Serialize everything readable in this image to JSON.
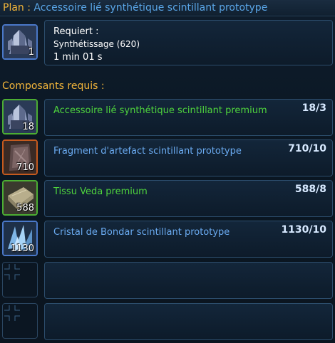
{
  "title": {
    "prefix": "Plan :",
    "name": "Accessoire lié synthétique scintillant prototype"
  },
  "requirements": {
    "label": "Requiert :",
    "skill": "Synthétissage (620)",
    "time": "1 min 01 s",
    "item_qty": "1"
  },
  "components_header": "Composants requis :",
  "components": [
    {
      "name": "Accessoire lié synthétique scintillant premium",
      "count": "18/3",
      "stock": "18",
      "name_color": "#4fd43d"
    },
    {
      "name": "Fragment d'artefact scintillant prototype",
      "count": "710/10",
      "stock": "710",
      "name_color": "#6aaaf0"
    },
    {
      "name": "Tissu Veda premium",
      "count": "588/8",
      "stock": "588",
      "name_color": "#4fd43d"
    },
    {
      "name": "Cristal de Bondar scintillant prototype",
      "count": "1130/10",
      "stock": "1130",
      "name_color": "#6aaaf0"
    }
  ],
  "colors": {
    "title_prefix": "#f2b53a",
    "title_name": "#5aa6e8",
    "premium_green": "#4fd43d",
    "prototype_blue": "#6aaaf0"
  },
  "icons": [
    "armor-crystal-icon",
    "artifact-fragment-icon",
    "veda-cloth-icon",
    "bondar-crystal-icon",
    "empty-slot-icon"
  ]
}
